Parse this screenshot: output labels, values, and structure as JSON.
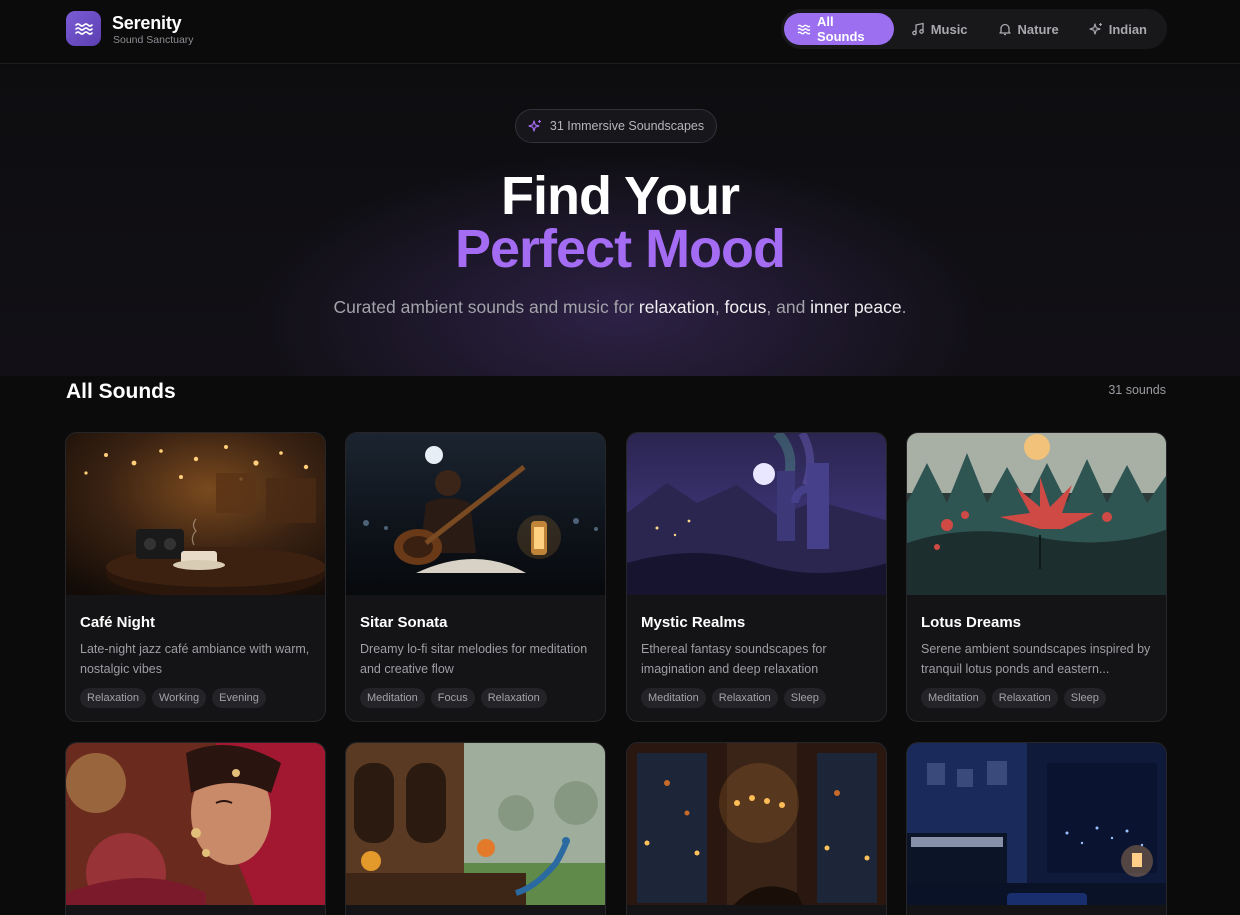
{
  "brand": {
    "name": "Serenity",
    "tagline": "Sound Sanctuary",
    "icon": "waves-icon"
  },
  "nav": [
    {
      "label": "All Sounds",
      "icon": "waves-icon",
      "active": true
    },
    {
      "label": "Music",
      "icon": "music-note-icon",
      "active": false
    },
    {
      "label": "Nature",
      "icon": "bell-icon",
      "active": false
    },
    {
      "label": "Indian",
      "icon": "sparkles-icon",
      "active": false
    }
  ],
  "hero": {
    "pill": "31 Immersive Soundscapes",
    "title_line1": "Find Your",
    "title_line2": "Perfect Mood",
    "sub_prefix": "Curated ambient sounds and music for ",
    "sub_hl1": "relaxation",
    "sub_sep1": ", ",
    "sub_hl2": "focus",
    "sub_sep2": ", and ",
    "sub_hl3": "inner peace",
    "sub_suffix": "."
  },
  "section": {
    "title": "All Sounds",
    "count": "31 sounds"
  },
  "cards": [
    {
      "title": "Café Night",
      "desc": "Late-night jazz café ambiance with warm, nostalgic vibes",
      "tags": [
        "Relaxation",
        "Working",
        "Evening"
      ]
    },
    {
      "title": "Sitar Sonata",
      "desc": "Dreamy lo-fi sitar melodies for meditation and creative flow",
      "tags": [
        "Meditation",
        "Focus",
        "Relaxation"
      ]
    },
    {
      "title": "Mystic Realms",
      "desc": "Ethereal fantasy soundscapes for imagination and deep relaxation",
      "tags": [
        "Meditation",
        "Relaxation",
        "Sleep"
      ]
    },
    {
      "title": "Lotus Dreams",
      "desc": "Serene ambient soundscapes inspired by tranquil lotus ponds and eastern...",
      "tags": [
        "Meditation",
        "Relaxation",
        "Sleep"
      ]
    }
  ],
  "colors": {
    "accent": "#9b6ff0",
    "accent_text": "#a46cf2",
    "background": "#0b0b0c",
    "card": "#141416"
  }
}
